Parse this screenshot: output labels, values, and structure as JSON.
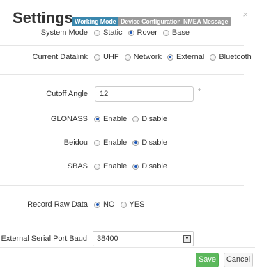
{
  "header": {
    "title": "Settings",
    "tabs": [
      {
        "label": "Working Mode",
        "active": true
      },
      {
        "label": "Device Configuration",
        "active": false
      },
      {
        "label": "NMEA Message",
        "active": false
      }
    ],
    "close_label": "×"
  },
  "form": {
    "system_mode": {
      "label": "System Mode",
      "options": [
        "Static",
        "Rover",
        "Base"
      ],
      "selected": "Rover"
    },
    "current_datalink": {
      "label": "Current Datalink",
      "options": [
        "UHF",
        "Network",
        "External",
        "Bluetooth"
      ],
      "selected": "External"
    },
    "cutoff_angle": {
      "label": "Cutoff Angle",
      "value": "12",
      "unit": "°"
    },
    "glonass": {
      "label": "GLONASS",
      "options": [
        "Enable",
        "Disable"
      ],
      "selected": "Enable"
    },
    "beidou": {
      "label": "Beidou",
      "options": [
        "Enable",
        "Disable"
      ],
      "selected": "Disable"
    },
    "sbas": {
      "label": "SBAS",
      "options": [
        "Enable",
        "Disable"
      ],
      "selected": "Disable"
    },
    "record_raw_data": {
      "label": "Record Raw Data",
      "options": [
        "NO",
        "YES"
      ],
      "selected": "NO"
    },
    "external_serial_port_baud": {
      "label": "External Serial Port Baud",
      "value": "38400"
    }
  },
  "footer": {
    "save_label": "Save",
    "cancel_label": "Cancel"
  },
  "colors": {
    "active_tab": "#3a87ad",
    "inactive_tab": "#999999",
    "save_button": "#5cb85c",
    "radio_checked": "#1a56b8"
  }
}
